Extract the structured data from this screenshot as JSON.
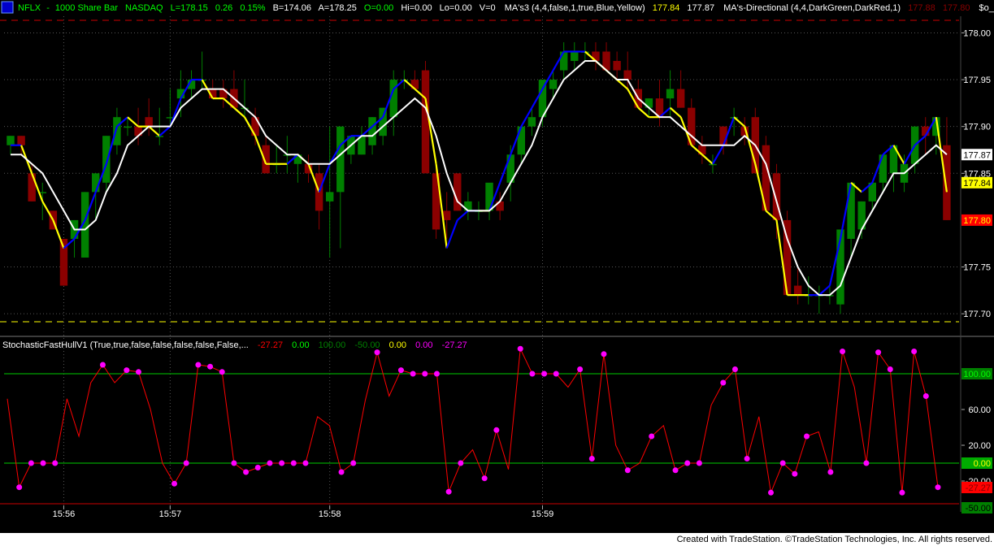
{
  "header": {
    "symbol": "NFLX",
    "interval": "1000 Share Bar",
    "exchange": "NASDAQ",
    "last": "L=178.15",
    "change": "0.26",
    "change_pct": "0.15%",
    "bid": "B=174.06",
    "ask": "A=178.25",
    "open": "O=0.00",
    "high": "Hi=0.00",
    "low": "Lo=0.00",
    "volume": "V=0",
    "ma3_label": "MA's3 (4,4,false,1,true,Blue,Yellow)",
    "ma3_v1": "177.84",
    "ma3_v2": "177.87",
    "madir_label": "MA's-Directional (4,4,DarkGreen,DarkRed,1)",
    "madir_v1": "177.88",
    "madir_v2": "177.80",
    "extra_label": "$o_Battll ..."
  },
  "indicator": {
    "label": "StochasticFastHullV1 (True,true,false,false,false,false,False,...",
    "v1": "-27.27",
    "v2": "0.00",
    "v3": "100.00",
    "v4": "-50.00",
    "v5": "0.00",
    "v6": "0.00",
    "v7": "-27.27"
  },
  "footer": {
    "text": "Created with TradeStation. ©TradeStation Technologies, Inc. All rights reserved."
  },
  "colors": {
    "up": "#008000",
    "down": "#8b0000",
    "blue_ma": "#0000ff",
    "yellow_ma": "#ffff00",
    "white_ma": "#ffffff",
    "stoch": "#ff0000",
    "stoch_dot": "#ff00ff",
    "hline": "#00ff00",
    "guide": "#ffff00"
  },
  "chart_data": [
    {
      "type": "candlestick",
      "x_tick_labels": [
        "15:56",
        "15:57",
        "15:58",
        "15:59"
      ],
      "x_tick_bar_index": [
        5,
        15,
        30,
        50
      ],
      "y_tick_labels": [
        "178.00",
        "177.95",
        "177.90",
        "177.85",
        "177.75",
        "177.70"
      ],
      "ylim": [
        177.688,
        178.016
      ],
      "price_markers": [
        {
          "value": 177.87,
          "label": "177.87",
          "bg": "#ffffff",
          "fg": "#000000"
        },
        {
          "value": 177.84,
          "label": "177.84",
          "bg": "#ffff00",
          "fg": "#000000"
        },
        {
          "value": 177.8,
          "label": "177.80",
          "bg": "#ff0000",
          "fg": "#ffff00"
        }
      ],
      "bars": [
        {
          "o": 177.88,
          "h": 177.89,
          "l": 177.87,
          "c": 177.89
        },
        {
          "o": 177.89,
          "h": 177.89,
          "l": 177.87,
          "c": 177.88
        },
        {
          "o": 177.85,
          "h": 177.86,
          "l": 177.82,
          "c": 177.82
        },
        {
          "o": 177.83,
          "h": 177.84,
          "l": 177.8,
          "c": 177.83
        },
        {
          "o": 177.81,
          "h": 177.81,
          "l": 177.79,
          "c": 177.79
        },
        {
          "o": 177.78,
          "h": 177.78,
          "l": 177.73,
          "c": 177.73
        },
        {
          "o": 177.78,
          "h": 177.8,
          "l": 177.76,
          "c": 177.8
        },
        {
          "o": 177.76,
          "h": 177.83,
          "l": 177.76,
          "c": 177.83
        },
        {
          "o": 177.83,
          "h": 177.85,
          "l": 177.8,
          "c": 177.85
        },
        {
          "o": 177.84,
          "h": 177.89,
          "l": 177.83,
          "c": 177.89
        },
        {
          "o": 177.88,
          "h": 177.92,
          "l": 177.87,
          "c": 177.91
        },
        {
          "o": 177.9,
          "h": 177.91,
          "l": 177.89,
          "c": 177.9
        },
        {
          "o": 177.9,
          "h": 177.92,
          "l": 177.88,
          "c": 177.89
        },
        {
          "o": 177.91,
          "h": 177.93,
          "l": 177.89,
          "c": 177.9
        },
        {
          "o": 177.89,
          "h": 177.92,
          "l": 177.88,
          "c": 177.89
        },
        {
          "o": 177.91,
          "h": 177.94,
          "l": 177.9,
          "c": 177.91
        },
        {
          "o": 177.93,
          "h": 177.96,
          "l": 177.91,
          "c": 177.94
        },
        {
          "o": 177.94,
          "h": 177.96,
          "l": 177.93,
          "c": 177.95
        },
        {
          "o": 177.95,
          "h": 177.98,
          "l": 177.94,
          "c": 177.95
        },
        {
          "o": 177.94,
          "h": 177.95,
          "l": 177.93,
          "c": 177.93
        },
        {
          "o": 177.94,
          "h": 177.95,
          "l": 177.92,
          "c": 177.93
        },
        {
          "o": 177.94,
          "h": 177.96,
          "l": 177.92,
          "c": 177.92
        },
        {
          "o": 177.92,
          "h": 177.95,
          "l": 177.91,
          "c": 177.92
        },
        {
          "o": 177.91,
          "h": 177.92,
          "l": 177.88,
          "c": 177.89
        },
        {
          "o": 177.88,
          "h": 177.89,
          "l": 177.85,
          "c": 177.85
        },
        {
          "o": 177.86,
          "h": 177.88,
          "l": 177.85,
          "c": 177.86
        },
        {
          "o": 177.87,
          "h": 177.89,
          "l": 177.85,
          "c": 177.87
        },
        {
          "o": 177.86,
          "h": 177.87,
          "l": 177.84,
          "c": 177.87
        },
        {
          "o": 177.86,
          "h": 177.87,
          "l": 177.84,
          "c": 177.85
        },
        {
          "o": 177.85,
          "h": 177.86,
          "l": 177.79,
          "c": 177.81
        },
        {
          "o": 177.82,
          "h": 177.9,
          "l": 177.76,
          "c": 177.83
        },
        {
          "o": 177.83,
          "h": 177.89,
          "l": 177.77,
          "c": 177.9
        },
        {
          "o": 177.87,
          "h": 177.89,
          "l": 177.86,
          "c": 177.89
        },
        {
          "o": 177.87,
          "h": 177.9,
          "l": 177.87,
          "c": 177.89
        },
        {
          "o": 177.88,
          "h": 177.91,
          "l": 177.87,
          "c": 177.91
        },
        {
          "o": 177.89,
          "h": 177.92,
          "l": 177.88,
          "c": 177.92
        },
        {
          "o": 177.91,
          "h": 177.96,
          "l": 177.89,
          "c": 177.95
        },
        {
          "o": 177.95,
          "h": 177.96,
          "l": 177.94,
          "c": 177.95
        },
        {
          "o": 177.95,
          "h": 177.96,
          "l": 177.94,
          "c": 177.94
        },
        {
          "o": 177.96,
          "h": 177.97,
          "l": 177.92,
          "c": 177.85
        },
        {
          "o": 177.85,
          "h": 177.86,
          "l": 177.78,
          "c": 177.79
        },
        {
          "o": 177.81,
          "h": 177.83,
          "l": 177.78,
          "c": 177.8
        },
        {
          "o": 177.85,
          "h": 177.85,
          "l": 177.81,
          "c": 177.81
        },
        {
          "o": 177.81,
          "h": 177.83,
          "l": 177.8,
          "c": 177.82
        },
        {
          "o": 177.81,
          "h": 177.82,
          "l": 177.8,
          "c": 177.81
        },
        {
          "o": 177.81,
          "h": 177.83,
          "l": 177.8,
          "c": 177.84
        },
        {
          "o": 177.82,
          "h": 177.83,
          "l": 177.8,
          "c": 177.81
        },
        {
          "o": 177.84,
          "h": 177.88,
          "l": 177.82,
          "c": 177.87
        },
        {
          "o": 177.87,
          "h": 177.9,
          "l": 177.86,
          "c": 177.9
        },
        {
          "o": 177.9,
          "h": 177.92,
          "l": 177.89,
          "c": 177.91
        },
        {
          "o": 177.91,
          "h": 177.93,
          "l": 177.9,
          "c": 177.95
        },
        {
          "o": 177.94,
          "h": 177.96,
          "l": 177.93,
          "c": 177.95
        },
        {
          "o": 177.96,
          "h": 177.99,
          "l": 177.95,
          "c": 177.98
        },
        {
          "o": 177.97,
          "h": 177.99,
          "l": 177.96,
          "c": 177.98
        },
        {
          "o": 177.98,
          "h": 177.99,
          "l": 177.97,
          "c": 177.98
        },
        {
          "o": 177.98,
          "h": 177.99,
          "l": 177.96,
          "c": 177.97
        },
        {
          "o": 177.98,
          "h": 177.99,
          "l": 177.96,
          "c": 177.96
        },
        {
          "o": 177.97,
          "h": 177.98,
          "l": 177.95,
          "c": 177.96
        },
        {
          "o": 177.96,
          "h": 177.98,
          "l": 177.94,
          "c": 177.95
        },
        {
          "o": 177.94,
          "h": 177.95,
          "l": 177.92,
          "c": 177.92
        },
        {
          "o": 177.92,
          "h": 177.93,
          "l": 177.91,
          "c": 177.93
        },
        {
          "o": 177.93,
          "h": 177.95,
          "l": 177.9,
          "c": 177.91
        },
        {
          "o": 177.93,
          "h": 177.96,
          "l": 177.91,
          "c": 177.94
        },
        {
          "o": 177.94,
          "h": 177.96,
          "l": 177.92,
          "c": 177.92
        },
        {
          "o": 177.92,
          "h": 177.93,
          "l": 177.88,
          "c": 177.88
        },
        {
          "o": 177.88,
          "h": 177.89,
          "l": 177.86,
          "c": 177.87
        },
        {
          "o": 177.86,
          "h": 177.87,
          "l": 177.85,
          "c": 177.86
        },
        {
          "o": 177.9,
          "h": 177.9,
          "l": 177.87,
          "c": 177.88
        },
        {
          "o": 177.91,
          "h": 177.92,
          "l": 177.89,
          "c": 177.91
        },
        {
          "o": 177.9,
          "h": 177.91,
          "l": 177.88,
          "c": 177.89
        },
        {
          "o": 177.91,
          "h": 177.92,
          "l": 177.85,
          "c": 177.85
        },
        {
          "o": 177.88,
          "h": 177.89,
          "l": 177.81,
          "c": 177.81
        },
        {
          "o": 177.85,
          "h": 177.86,
          "l": 177.78,
          "c": 177.8
        },
        {
          "o": 177.8,
          "h": 177.81,
          "l": 177.72,
          "c": 177.72
        },
        {
          "o": 177.73,
          "h": 177.75,
          "l": 177.71,
          "c": 177.72
        },
        {
          "o": 177.72,
          "h": 177.74,
          "l": 177.71,
          "c": 177.72
        },
        {
          "o": 177.72,
          "h": 177.73,
          "l": 177.7,
          "c": 177.72
        },
        {
          "o": 177.72,
          "h": 177.73,
          "l": 177.71,
          "c": 177.72
        },
        {
          "o": 177.71,
          "h": 177.79,
          "l": 177.7,
          "c": 177.79
        },
        {
          "o": 177.78,
          "h": 177.84,
          "l": 177.76,
          "c": 177.84
        },
        {
          "o": 177.79,
          "h": 177.82,
          "l": 177.78,
          "c": 177.82
        },
        {
          "o": 177.82,
          "h": 177.84,
          "l": 177.81,
          "c": 177.84
        },
        {
          "o": 177.84,
          "h": 177.87,
          "l": 177.83,
          "c": 177.87
        },
        {
          "o": 177.85,
          "h": 177.88,
          "l": 177.83,
          "c": 177.88
        },
        {
          "o": 177.84,
          "h": 177.87,
          "l": 177.83,
          "c": 177.86
        },
        {
          "o": 177.86,
          "h": 177.9,
          "l": 177.85,
          "c": 177.9
        },
        {
          "o": 177.9,
          "h": 177.91,
          "l": 177.87,
          "c": 177.89
        },
        {
          "o": 177.89,
          "h": 177.91,
          "l": 177.87,
          "c": 177.91
        },
        {
          "o": 177.88,
          "h": 177.91,
          "l": 177.8,
          "c": 177.8
        }
      ],
      "ma_blue_yellow": [
        177.88,
        177.88,
        177.85,
        177.82,
        177.8,
        177.77,
        177.78,
        177.8,
        177.83,
        177.86,
        177.9,
        177.91,
        177.9,
        177.9,
        177.89,
        177.9,
        177.93,
        177.95,
        177.95,
        177.93,
        177.93,
        177.92,
        177.91,
        177.89,
        177.86,
        177.86,
        177.86,
        177.87,
        177.86,
        177.83,
        177.86,
        177.88,
        177.89,
        177.89,
        177.9,
        177.91,
        177.94,
        177.95,
        177.94,
        177.93,
        177.86,
        177.77,
        177.8,
        177.81,
        177.81,
        177.81,
        177.84,
        177.87,
        177.9,
        177.92,
        177.94,
        177.96,
        177.98,
        177.98,
        177.98,
        177.97,
        177.96,
        177.95,
        177.94,
        177.92,
        177.91,
        177.91,
        177.92,
        177.91,
        177.88,
        177.87,
        177.86,
        177.88,
        177.91,
        177.9,
        177.86,
        177.81,
        177.8,
        177.72,
        177.72,
        177.72,
        177.72,
        177.73,
        177.78,
        177.84,
        177.83,
        177.84,
        177.87,
        177.88,
        177.86,
        177.88,
        177.89,
        177.91,
        177.83
      ],
      "ma_blue_yellow_dir": [
        1,
        1,
        0,
        0,
        0,
        0,
        1,
        1,
        1,
        1,
        1,
        1,
        0,
        0,
        0,
        1,
        1,
        1,
        1,
        0,
        0,
        0,
        0,
        0,
        0,
        0,
        0,
        1,
        0,
        0,
        1,
        1,
        1,
        1,
        1,
        1,
        1,
        1,
        0,
        0,
        0,
        0,
        1,
        1,
        1,
        0,
        1,
        1,
        1,
        1,
        1,
        1,
        1,
        1,
        1,
        0,
        0,
        0,
        0,
        0,
        0,
        0,
        1,
        0,
        0,
        0,
        0,
        1,
        1,
        0,
        0,
        0,
        0,
        0,
        0,
        0,
        1,
        1,
        1,
        1,
        0,
        1,
        1,
        1,
        0,
        1,
        1,
        1,
        0
      ],
      "ma_white": [
        177.87,
        177.87,
        177.86,
        177.85,
        177.83,
        177.81,
        177.79,
        177.79,
        177.8,
        177.83,
        177.85,
        177.88,
        177.89,
        177.9,
        177.9,
        177.9,
        177.92,
        177.93,
        177.94,
        177.94,
        177.94,
        177.93,
        177.92,
        177.91,
        177.89,
        177.88,
        177.87,
        177.87,
        177.86,
        177.86,
        177.86,
        177.87,
        177.88,
        177.89,
        177.89,
        177.9,
        177.91,
        177.92,
        177.93,
        177.92,
        177.89,
        177.85,
        177.82,
        177.81,
        177.81,
        177.81,
        177.82,
        177.84,
        177.86,
        177.88,
        177.91,
        177.93,
        177.95,
        177.96,
        177.97,
        177.97,
        177.96,
        177.95,
        177.95,
        177.93,
        177.92,
        177.91,
        177.91,
        177.9,
        177.89,
        177.88,
        177.88,
        177.88,
        177.88,
        177.89,
        177.88,
        177.86,
        177.82,
        177.78,
        177.75,
        177.73,
        177.72,
        177.72,
        177.73,
        177.76,
        177.79,
        177.81,
        177.83,
        177.85,
        177.85,
        177.86,
        177.87,
        177.88,
        177.87
      ]
    },
    {
      "type": "line",
      "title": "StochasticFastHullV1",
      "y_tick_labels": [
        "100.00",
        "60.00",
        "20.00",
        "0.00",
        "-20.00",
        "-27.27",
        "-50.00"
      ],
      "ylim": [
        -50,
        120
      ],
      "reference_lines": [
        100,
        0
      ],
      "values": [
        72,
        -27,
        0,
        0,
        0,
        72,
        30,
        90,
        110,
        90,
        104,
        102,
        60,
        0,
        -23,
        0,
        110,
        108,
        102,
        0,
        -10,
        -5,
        0,
        0,
        0,
        0,
        52,
        42,
        -10,
        0,
        70,
        124,
        75,
        104,
        100,
        100,
        100,
        -32,
        0,
        15,
        -17,
        37,
        -7,
        128,
        100,
        100,
        100,
        85,
        105,
        5,
        122,
        20,
        -8,
        0,
        30,
        42,
        -8,
        0,
        0,
        65,
        90,
        105,
        5,
        52,
        -33,
        0,
        -12,
        30,
        35,
        -10,
        125,
        85,
        0,
        124,
        105,
        -33,
        125,
        75,
        -27
      ],
      "markers_at": [
        1,
        2,
        3,
        4,
        8,
        10,
        11,
        14,
        15,
        16,
        17,
        18,
        19,
        20,
        21,
        22,
        23,
        24,
        25,
        28,
        29,
        31,
        33,
        34,
        35,
        36,
        37,
        38,
        40,
        41,
        43,
        44,
        45,
        46,
        48,
        49,
        50,
        52,
        54,
        56,
        57,
        58,
        60,
        61,
        62,
        64,
        65,
        66,
        67,
        69,
        70,
        72,
        73,
        74,
        75,
        76,
        77,
        78
      ]
    }
  ]
}
